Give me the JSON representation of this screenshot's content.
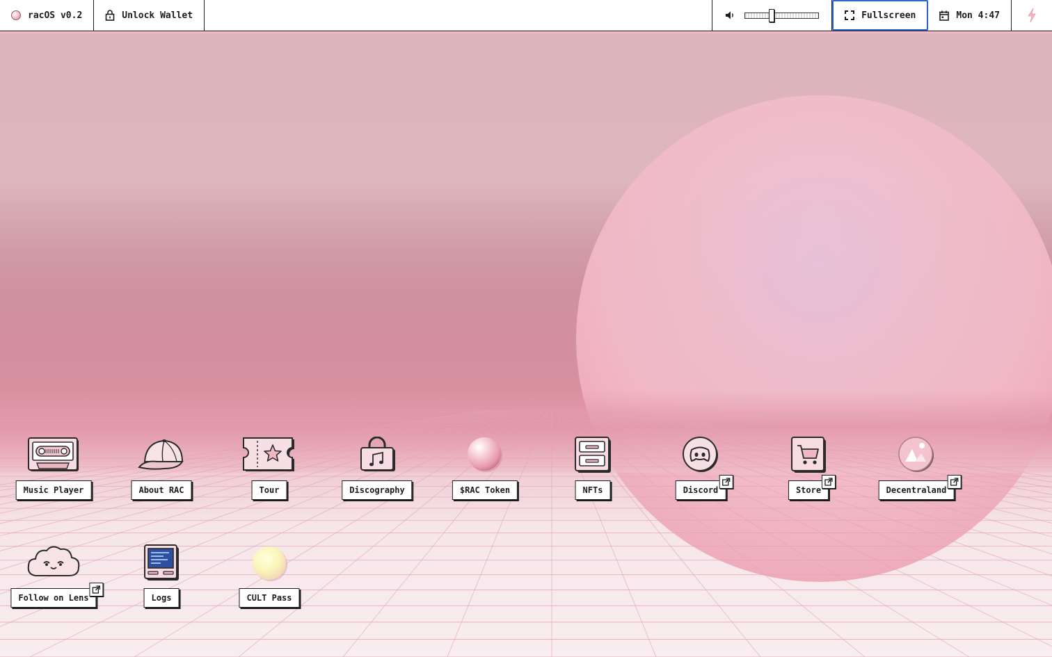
{
  "menubar": {
    "app_name": "racOS v0.2",
    "wallet_label": "Unlock Wallet",
    "volume_level": 0.35,
    "fullscreen_label": "Fullscreen",
    "clock": "Mon 4:47"
  },
  "icons": [
    {
      "label": "Music Player",
      "icon": "cassette-icon",
      "external": false
    },
    {
      "label": "About RAC",
      "icon": "cap-icon",
      "external": false
    },
    {
      "label": "Tour",
      "icon": "ticket-icon",
      "external": false
    },
    {
      "label": "Discography",
      "icon": "music-bag-icon",
      "external": false
    },
    {
      "label": "$RAC Token",
      "icon": "pearl-icon",
      "external": false
    },
    {
      "label": "NFTs",
      "icon": "cabinet-icon",
      "external": false
    },
    {
      "label": "Discord",
      "icon": "discord-icon",
      "external": true
    },
    {
      "label": "Store",
      "icon": "cart-icon",
      "external": true
    },
    {
      "label": "Decentraland",
      "icon": "decentraland-icon",
      "external": true
    },
    {
      "label": "Follow on Lens",
      "icon": "cloud-face-icon",
      "external": true
    },
    {
      "label": "Logs",
      "icon": "monitor-icon",
      "external": false
    },
    {
      "label": "CULT Pass",
      "icon": "yellow-orb-icon",
      "external": false
    }
  ],
  "colors": {
    "accent_blue": "#2b66c9",
    "pink_sun": "#f2b9c6",
    "grid_line": "#e2a3b3"
  }
}
